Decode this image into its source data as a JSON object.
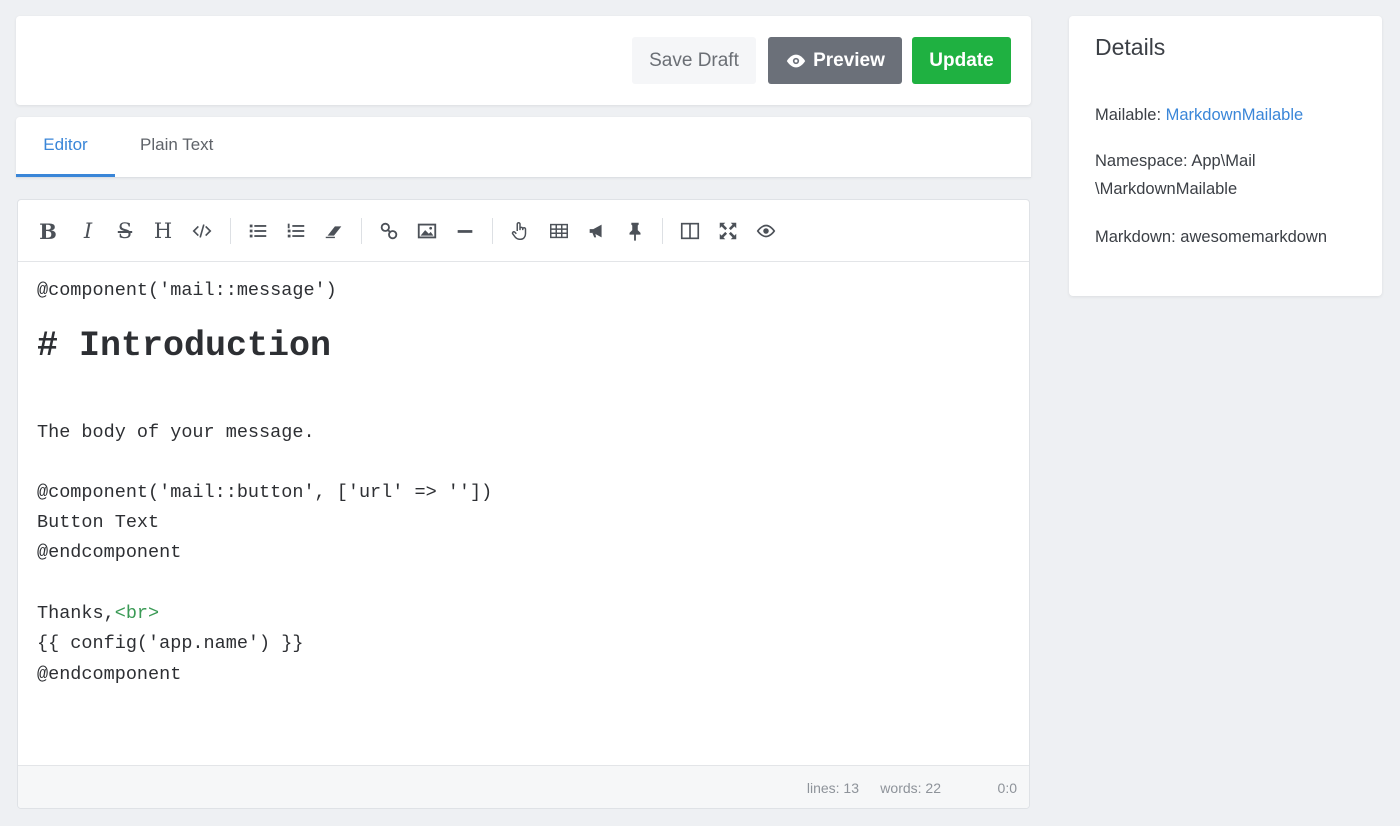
{
  "actions": {
    "save_draft": "Save Draft",
    "preview": "Preview",
    "update": "Update"
  },
  "tabs": [
    {
      "label": "Editor",
      "active": true
    },
    {
      "label": "Plain Text",
      "active": false
    }
  ],
  "toolbar": {
    "bold": "B",
    "italic": "I",
    "strike": "S",
    "heading": "H"
  },
  "editor": {
    "lines": [
      "@component('mail::message')",
      "# Introduction",
      "The body of your message.",
      "@component('mail::button', ['url' => ''])",
      "Button Text",
      "@endcomponent",
      "Thanks,",
      "{{ config('app.name') }}",
      "@endcomponent"
    ],
    "br_tag": "<br>"
  },
  "status": {
    "lines": "lines: 13",
    "words": "words: 22",
    "cursor": "0:0"
  },
  "details": {
    "title": "Details",
    "mailable_key": "Mailable:",
    "mailable_value": "MarkdownMailable",
    "namespace_key": "Namespace:",
    "namespace_value_1": "App\\Mail",
    "namespace_value_2": "\\MarkdownMailable",
    "markdown_key": "Markdown:",
    "markdown_value": "awesomemarkdown"
  },
  "colors": {
    "accent": "#3a86d8",
    "update": "#1fb141",
    "preview": "#6b7079"
  }
}
